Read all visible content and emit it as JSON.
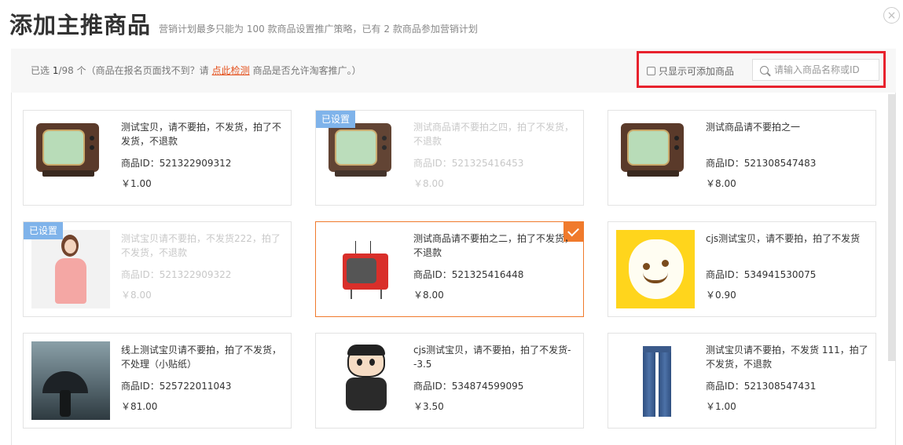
{
  "header": {
    "title": "添加主推商品",
    "subtitle": "营销计划最多只能为 100 款商品设置推广策略，已有 2 款商品参加营销计划"
  },
  "toolbar": {
    "selected_prefix": "已选 ",
    "selected_count": "1",
    "selected_total": "/98 个",
    "hint_before": "（商品在报名页面找不到？请",
    "hint_link": "点此检测",
    "hint_after": "商品是否允许淘客推广。）",
    "filter_label": "只显示可添加商品",
    "search_placeholder": "请输入商品名称或ID"
  },
  "products": [
    {
      "name": "测试宝贝，请不要拍，不发货，拍了不发货，不退款",
      "id": "商品ID：521322909312",
      "price": "￥1.00",
      "tag": "",
      "thumb": "tv-icon"
    },
    {
      "name": "测试商品请不要拍之四，拍了不发货，不退款",
      "id": "商品ID：521325416453",
      "price": "￥8.00",
      "tag": "已设置",
      "thumb": "tv-icon"
    },
    {
      "name": "测试商品请不要拍之一",
      "id": "商品ID：521308547483",
      "price": "￥8.00",
      "tag": "",
      "thumb": "tv-icon"
    },
    {
      "name": "测试宝贝请不要拍，不发货222，拍了不发货，不退款",
      "id": "商品ID：521322909322",
      "price": "￥8.00",
      "tag": "已设置",
      "thumb": "dress-photo"
    },
    {
      "name": "测试商品请不要拍之二，拍了不发货，不退款",
      "id": "商品ID：521325416448",
      "price": "￥8.00",
      "tag": "",
      "thumb": "red-tv-icon"
    },
    {
      "name": "cjs测试宝贝，请不要拍，拍了不发货",
      "id": "商品ID：534941530075",
      "price": "￥0.90",
      "tag": "",
      "thumb": "smiley-icon"
    },
    {
      "name": "线上测试宝贝请不要拍，拍了不发货，不处理（小贴纸）",
      "id": "商品ID：525722011043",
      "price": "￥81.00",
      "tag": "",
      "thumb": "umbrella-photo"
    },
    {
      "name": "cjs测试宝贝，请不要拍，拍了不发货--3.5",
      "id": "商品ID：534874599095",
      "price": "￥3.50",
      "tag": "",
      "thumb": "cartoon-icon"
    },
    {
      "name": "测试宝贝请不要拍，不发货 111，拍了不发货，不退款",
      "id": "商品ID：521308547431",
      "price": "￥1.00",
      "tag": "",
      "thumb": "jeans-photo"
    }
  ],
  "colors": {
    "accent": "#f07a2c",
    "link": "#e4501c",
    "tag": "#7fb3ea",
    "highlight_box": "#e8222d"
  }
}
